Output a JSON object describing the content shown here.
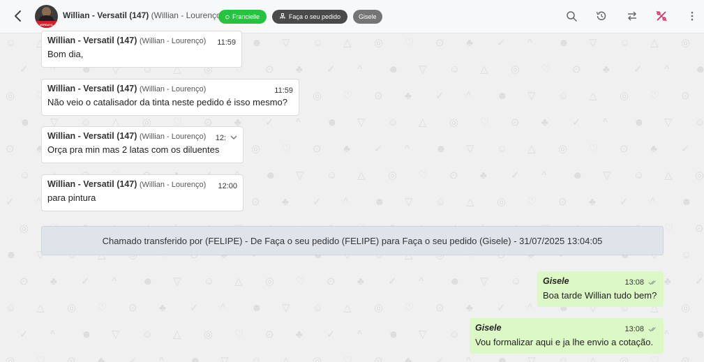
{
  "header": {
    "contact_name": "Willian - Versatil (147)",
    "contact_sub": "(Willian - Lourenço)",
    "avatar_text": "VERSATIL",
    "tags": {
      "agent_tag": "Francielle",
      "queue_tag": "Faça o seu pedido",
      "user_tag": "Gisele"
    },
    "icons": [
      "back-arrow-icon",
      "search-icon",
      "history-icon",
      "transfer-icon",
      "percent-icon",
      "more-vertical-icon"
    ],
    "colors": {
      "agent_tag": "#25c33f",
      "queue_tag": "#4a4a4a",
      "user_tag": "#757575",
      "percent_icon": "#e0245e"
    }
  },
  "messages": {
    "incoming": [
      {
        "name": "Willian - Versatil (147)",
        "sub": "(Willian - Lourenço)",
        "time": "11:59",
        "text": "Bom dia,"
      },
      {
        "name": "Willian - Versatil (147)",
        "sub": "(Willian - Lourenço)",
        "time": "11:59",
        "text": "Não veio o catalisador da tinta neste pedido é isso mesmo?"
      },
      {
        "name": "Willian - Versatil (147)",
        "sub": "(Willian - Lourenço)",
        "time": "12:",
        "text": "Orça pra min mas 2 latas com os diluentes"
      },
      {
        "name": "Willian - Versatil (147)",
        "sub": "(Willian - Lourenço)",
        "time": "12:00",
        "text": "para pintura"
      }
    ],
    "system": "Chamado transferido por (FELIPE) - De Faça o seu pedido (FELIPE) para Faça o seu pedido (Gisele) - 31/07/2025 13:04:05",
    "outgoing": [
      {
        "name": "Gisele",
        "time": "13:08",
        "text": "Boa tarde Willian tudo bem?"
      },
      {
        "name": "Gisele",
        "time": "13:08",
        "text": "Vou formalizar aqui e ja lhe envio a cotação."
      }
    ],
    "colors": {
      "outgoing_bubble": "#dcf8c6",
      "system_banner": "#dfe3ea"
    }
  }
}
